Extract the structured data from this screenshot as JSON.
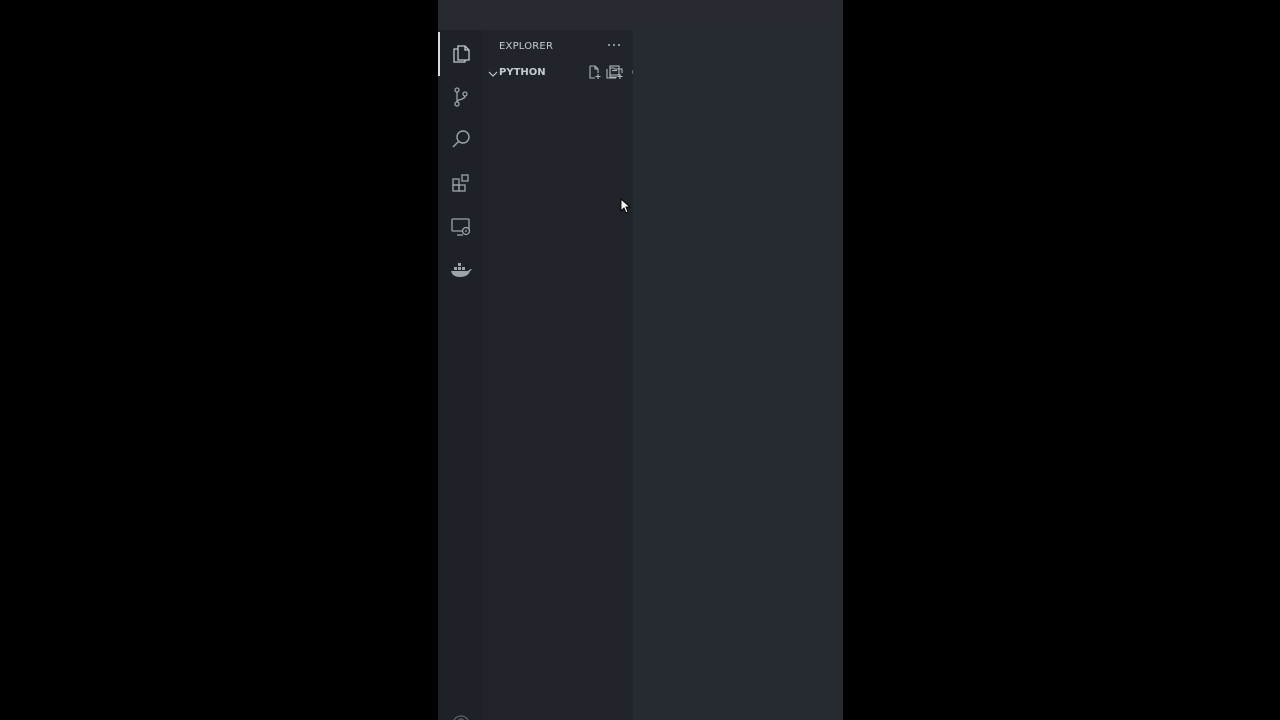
{
  "explorer": {
    "title": "EXPLORER",
    "more_actions_icon": "ellipsis-icon",
    "section": {
      "title": "PYTHON",
      "expanded": true,
      "actions": [
        {
          "name": "new-file-button",
          "icon": "new-file-icon"
        },
        {
          "name": "new-folder-button",
          "icon": "new-folder-icon"
        },
        {
          "name": "refresh-explorer-button",
          "icon": "refresh-icon"
        },
        {
          "name": "collapse-folders-button",
          "icon": "collapse-all-icon"
        }
      ]
    }
  },
  "activity_bar": {
    "items": [
      {
        "name": "explorer",
        "icon": "files-icon",
        "active": true
      },
      {
        "name": "source-control",
        "icon": "source-control-icon",
        "active": false
      },
      {
        "name": "search",
        "icon": "search-icon",
        "active": false
      },
      {
        "name": "extensions",
        "icon": "extensions-icon",
        "active": false
      },
      {
        "name": "remote-explorer",
        "icon": "remote-explorer-icon",
        "active": false
      },
      {
        "name": "docker",
        "icon": "docker-icon",
        "active": false
      }
    ]
  },
  "colors": {
    "activity_bar_bg": "#1e2127",
    "sidebar_bg": "#21252b",
    "editor_bg": "#262a31",
    "icon_color": "#c2c6cd",
    "active_indicator": "#d7dae0"
  }
}
